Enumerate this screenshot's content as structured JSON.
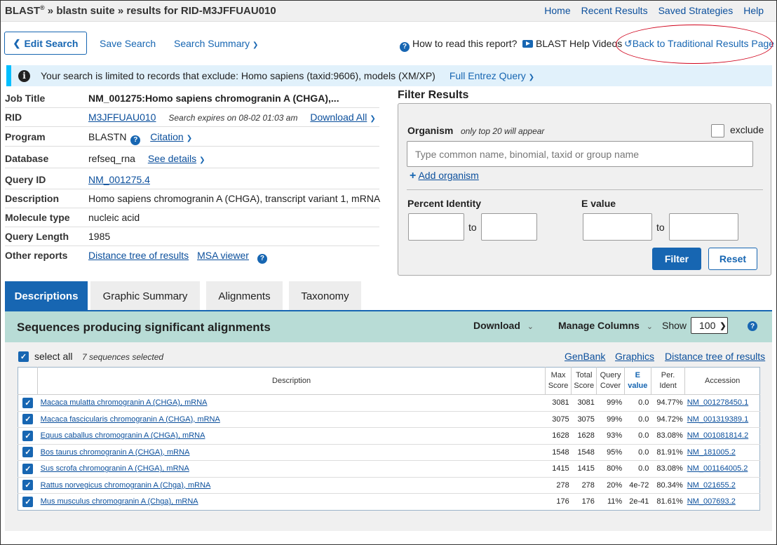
{
  "header": {
    "brand": "BLAST",
    "reg": "®",
    "crumb": " » blastn suite » results for RID-M3JFFUAU010",
    "nav": [
      "Home",
      "Recent Results",
      "Saved Strategies",
      "Help"
    ]
  },
  "toolbar": {
    "edit_search": "Edit Search",
    "save_search": "Save Search",
    "search_summary": "Search Summary",
    "how_to_read": "How to read this report?",
    "help_videos": "BLAST Help Videos",
    "back_traditional": "Back to Traditional Results Page"
  },
  "notice": {
    "text": "Your search is limited to records that exclude: Homo sapiens (taxid:9606), models (XM/XP)",
    "link": "Full Entrez Query"
  },
  "job": {
    "title_label": "Job Title",
    "title_value": "NM_001275:Homo sapiens chromogranin A (CHGA),...",
    "rid_label": "RID",
    "rid_value": "M3JFFUAU010",
    "rid_expires": "Search expires on 08-02 01:03 am",
    "download_all": "Download All",
    "program_label": "Program",
    "program_value": "BLASTN",
    "citation": "Citation",
    "database_label": "Database",
    "database_value": "refseq_rna",
    "see_details": "See details",
    "query_id_label": "Query ID",
    "query_id_value": "NM_001275.4",
    "description_label": "Description",
    "description_value": "Homo sapiens chromogranin A (CHGA), transcript variant 1, mRNA",
    "molecule_label": "Molecule type",
    "molecule_value": "nucleic acid",
    "length_label": "Query Length",
    "length_value": "1985",
    "other_label": "Other reports",
    "distance_tree": "Distance tree of results",
    "msa_viewer": "MSA viewer"
  },
  "filter": {
    "title": "Filter Results",
    "organism_label": "Organism",
    "organism_note": "only top 20 will appear",
    "exclude": "exclude",
    "organism_placeholder": "Type common  name, binomial, taxid or group  name",
    "add_organism": "Add organism",
    "percent_identity": "Percent Identity",
    "e_value": "E value",
    "to": "to",
    "filter_btn": "Filter",
    "reset_btn": "Reset"
  },
  "tabs": [
    "Descriptions",
    "Graphic Summary",
    "Alignments",
    "Taxonomy"
  ],
  "results": {
    "heading": "Sequences producing significant alignments",
    "download": "Download",
    "manage_columns": "Manage Columns",
    "show": "Show",
    "show_value": "100",
    "select_all": "select all",
    "selected_note": "7 sequences selected",
    "links": [
      "GenBank",
      "Graphics",
      "Distance tree of results"
    ],
    "columns": {
      "description": "Description",
      "max1": "Max",
      "max2": "Score",
      "total1": "Total",
      "total2": "Score",
      "query1": "Query",
      "query2": "Cover",
      "e1": "E",
      "e2": "value",
      "per1": "Per.",
      "per2": "Ident",
      "accession": "Accession"
    },
    "rows": [
      {
        "desc": "Macaca mulatta chromogranin A (CHGA), mRNA",
        "max": "3081",
        "total": "3081",
        "cover": "99%",
        "e": "0.0",
        "ident": "94.77%",
        "acc": "NM_001278450.1"
      },
      {
        "desc": "Macaca fascicularis chromogranin A (CHGA), mRNA",
        "max": "3075",
        "total": "3075",
        "cover": "99%",
        "e": "0.0",
        "ident": "94.72%",
        "acc": "NM_001319389.1"
      },
      {
        "desc": "Equus caballus chromogranin A (CHGA), mRNA",
        "max": "1628",
        "total": "1628",
        "cover": "93%",
        "e": "0.0",
        "ident": "83.08%",
        "acc": "NM_001081814.2"
      },
      {
        "desc": "Bos taurus chromogranin A (CHGA), mRNA",
        "max": "1548",
        "total": "1548",
        "cover": "95%",
        "e": "0.0",
        "ident": "81.91%",
        "acc": "NM_181005.2"
      },
      {
        "desc": "Sus scrofa chromogranin A (CHGA), mRNA",
        "max": "1415",
        "total": "1415",
        "cover": "80%",
        "e": "0.0",
        "ident": "83.08%",
        "acc": "NM_001164005.2"
      },
      {
        "desc": "Rattus norvegicus chromogranin A (Chga), mRNA",
        "max": "278",
        "total": "278",
        "cover": "20%",
        "e": "4e-72",
        "ident": "80.34%",
        "acc": "NM_021655.2"
      },
      {
        "desc": "Mus musculus chromogranin A (Chga), mRNA",
        "max": "176",
        "total": "176",
        "cover": "11%",
        "e": "2e-41",
        "ident": "81.61%",
        "acc": "NM_007693.2"
      }
    ]
  },
  "colors": {
    "accent": "#1766b2",
    "notice_bg": "#e1f1fb",
    "notice_bar": "#00bfff",
    "results_header": "#b8dcd6",
    "highlight_oval": "#d0021b"
  }
}
